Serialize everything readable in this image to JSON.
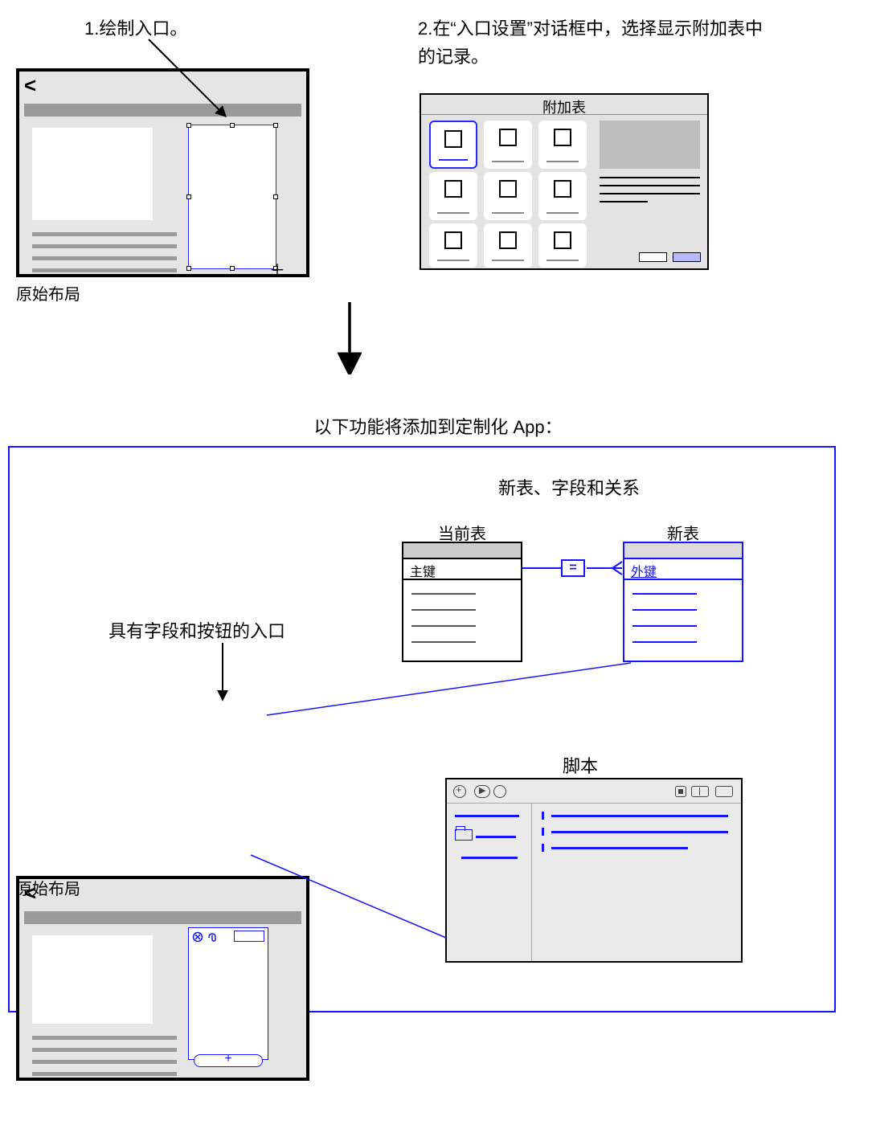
{
  "step1": {
    "text": "1.绘制入口。",
    "caption": "原始布局"
  },
  "step2": {
    "text": "2.在“入口设置”对话框中，选择显示附加表中的记录。",
    "dialog_title": "附加表"
  },
  "result": {
    "heading": "以下功能将添加到定制化 App：",
    "portal_label": "具有字段和按钮的入口",
    "layout_caption": "原始布局",
    "tables_title": "新表、字段和关系",
    "current_table": "当前表",
    "new_table": "新表",
    "primary_key": "主键",
    "foreign_key": "外键",
    "relation_symbol": "=",
    "scripts_title": "脚本",
    "portal_add": "+"
  },
  "symbols": {
    "back": "<"
  }
}
